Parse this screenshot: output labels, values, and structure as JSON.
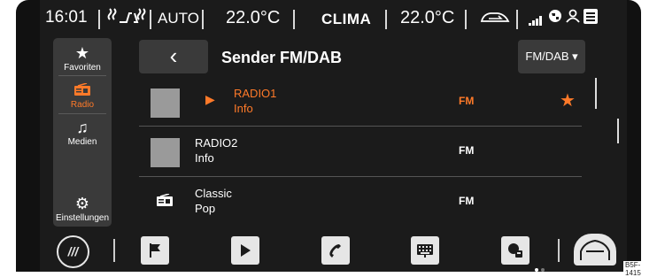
{
  "statusbar": {
    "time": "16:01",
    "seat_icons": "seat-heating-icons",
    "mode": "AUTO",
    "temp_left": "22.0°C",
    "center_label": "CLIMA",
    "temp_right": "22.0°C",
    "status_icons": [
      "car-recirculation-icon",
      "signal-icon",
      "globe-icon",
      "user-icon",
      "menu-icon"
    ]
  },
  "sidebar": {
    "items": [
      {
        "label": "Favoriten",
        "icon": "star-icon"
      },
      {
        "label": "Radio",
        "icon": "radio-icon",
        "active": true
      },
      {
        "label": "Medien",
        "icon": "music-note-icon"
      },
      {
        "label": "Einstellungen",
        "icon": "gear-icon"
      }
    ]
  },
  "header": {
    "back_icon": "‹",
    "title": "Sender FM/DAB",
    "band_select": "FM/DAB ▾"
  },
  "stations": [
    {
      "name": "RADIO1",
      "info": "Info",
      "band": "FM",
      "active": true,
      "favorite": true
    },
    {
      "name": "RADIO2",
      "info": "Info",
      "band": "FM"
    },
    {
      "name": "Classic",
      "info": "Pop",
      "band": "FM"
    }
  ],
  "dock": {
    "home_label": "///",
    "items": [
      "flag-icon",
      "play-icon",
      "phone-icon",
      "keyboard-icon",
      "fuel-icon",
      "car-icon"
    ]
  },
  "image_code": "B5F-1415",
  "colors": {
    "accent": "#ff7a29",
    "background": "#1b1b1b",
    "panel": "#3a3a3a"
  }
}
